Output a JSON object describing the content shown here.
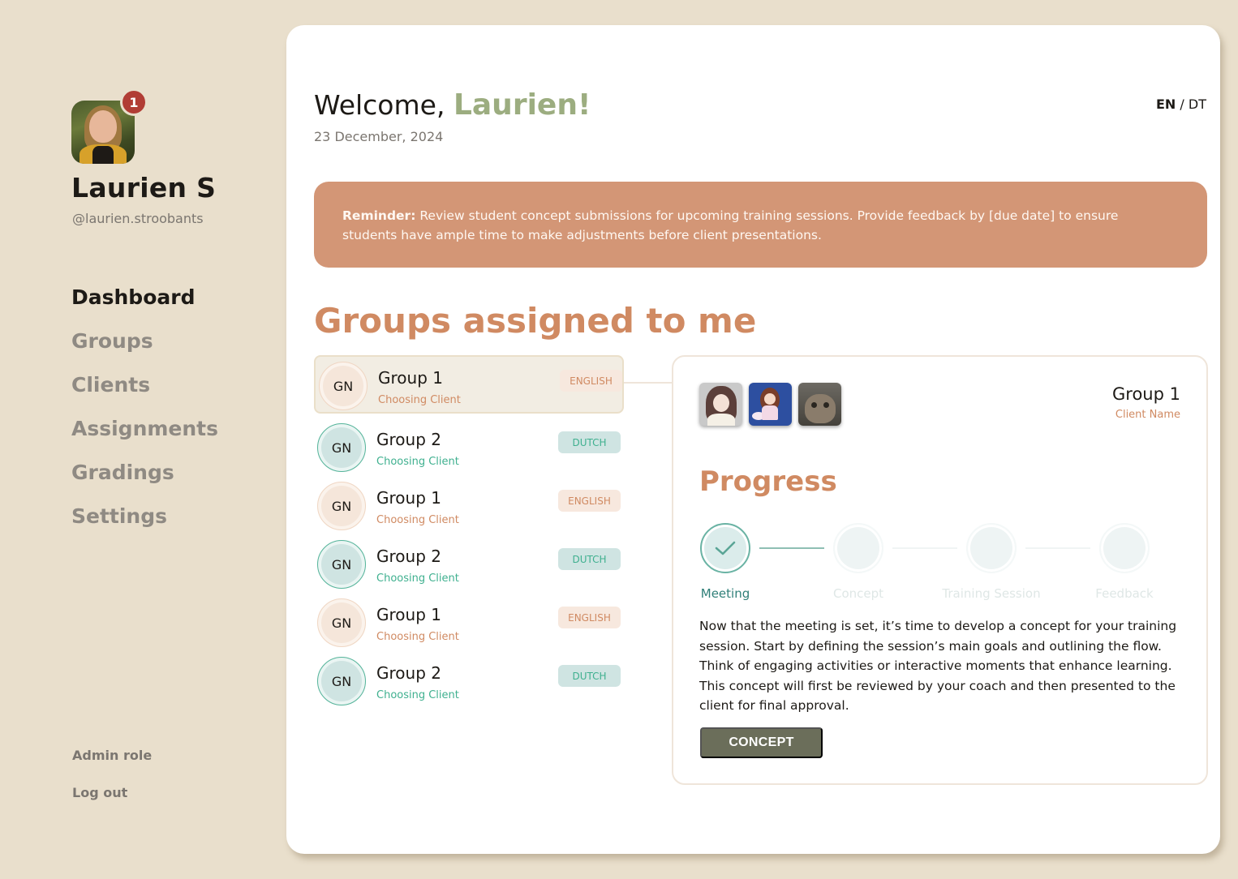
{
  "sidebar": {
    "notification_count": "1",
    "user_name": "Laurien S",
    "user_handle": "@laurien.stroobants",
    "nav": [
      "Dashboard",
      "Groups",
      "Clients",
      "Assignments",
      "Gradings",
      "Settings"
    ],
    "admin_role": "Admin role",
    "logout": "Log out"
  },
  "header": {
    "welcome_prefix": "Welcome,",
    "welcome_name": "Laurien!",
    "date": "23 December, 2024",
    "lang_en": "EN",
    "lang_sep": "/",
    "lang_dt": "DT"
  },
  "reminder": {
    "label": "Reminder:",
    "text": "Review student concept submissions for upcoming training sessions. Provide feedback by [due date] to ensure students have ample time to make adjustments before client presentations."
  },
  "groups": {
    "title": "Groups assigned to me",
    "items": [
      {
        "initials": "GN",
        "name": "Group 1",
        "status": "Choosing Client",
        "language": "ENGLISH"
      },
      {
        "initials": "GN",
        "name": "Group 2",
        "status": "Choosing Client",
        "language": "DUTCH"
      },
      {
        "initials": "GN",
        "name": "Group 1",
        "status": "Choosing Client",
        "language": "ENGLISH"
      },
      {
        "initials": "GN",
        "name": "Group 2",
        "status": "Choosing Client",
        "language": "DUTCH"
      },
      {
        "initials": "GN",
        "name": "Group 1",
        "status": "Choosing Client",
        "language": "ENGLISH"
      },
      {
        "initials": "GN",
        "name": "Group 2",
        "status": "Choosing Client",
        "language": "DUTCH"
      }
    ]
  },
  "detail": {
    "group_name": "Group 1",
    "client_name": "Client Name",
    "progress_title": "Progress",
    "steps": [
      "Meeting",
      "Concept",
      "Training Session",
      "Feedback"
    ],
    "completed_steps": 1,
    "description": "Now that the meeting is set, it’s time to develop a concept for your training session. Start by defining the session’s main goals and outlining the flow. Think of engaging activities or interactive moments that enhance learning. This concept will first be reviewed by your coach and then presented to the client for final approval.",
    "button": "CONCEPT"
  },
  "colors": {
    "background": "#e9dfcc",
    "accent_green": "#9cad80",
    "accent_orange": "#d08a62",
    "reminder_bg": "#d39676",
    "teal": "#3fb08f",
    "button": "#6b6e5a"
  },
  "icons": [
    "checkmark-icon"
  ]
}
